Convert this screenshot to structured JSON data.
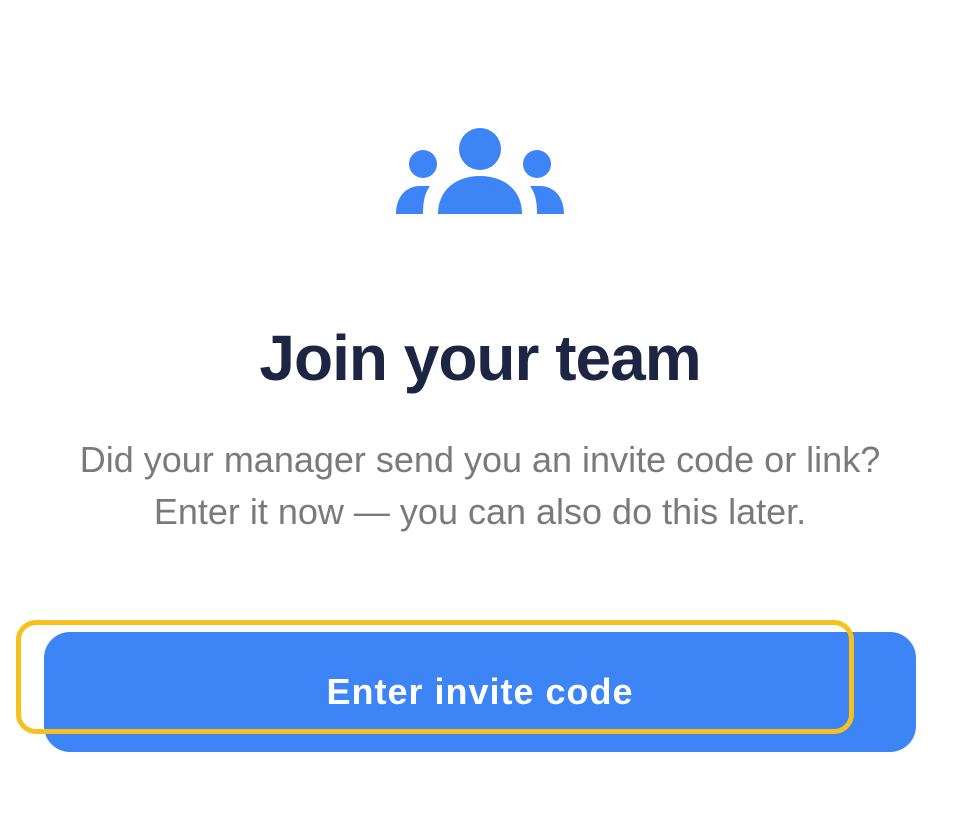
{
  "icon": {
    "name": "team-icon",
    "color": "#3d84f6"
  },
  "title": "Join your team",
  "subtitle": "Did your manager send you an invite code or link? Enter it now — you can also do this later.",
  "primary_button": {
    "label": "Enter invite code",
    "background": "#3d84f6",
    "text_color": "#ffffff"
  },
  "highlight": {
    "color": "#f8c01a"
  }
}
